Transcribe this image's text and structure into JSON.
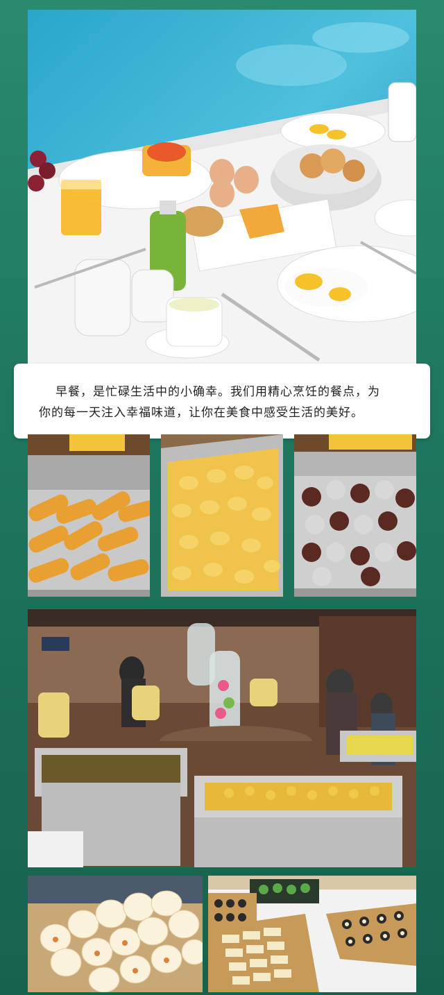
{
  "caption": {
    "line1": "早餐，是忙碌生活中的小确幸。我们用精心烹饪的餐点，为",
    "line2": "你的每一天注入幸福味道，让你在美食中感受生活的美好。"
  },
  "photos": {
    "hero": "breakfast-table-photo",
    "spring_rolls": "spring-rolls-tray-photo",
    "fried_potatoes": "fried-potato-tray-photo",
    "chocolate_cakes": "chocolate-cupcakes-tray-photo",
    "buffet": "buffet-hall-photo",
    "buns": "steamed-buns-photo",
    "sushi": "sushi-platter-photo"
  },
  "colors": {
    "frame": "#1f7a60",
    "card": "#ffffff",
    "text": "#222222"
  }
}
